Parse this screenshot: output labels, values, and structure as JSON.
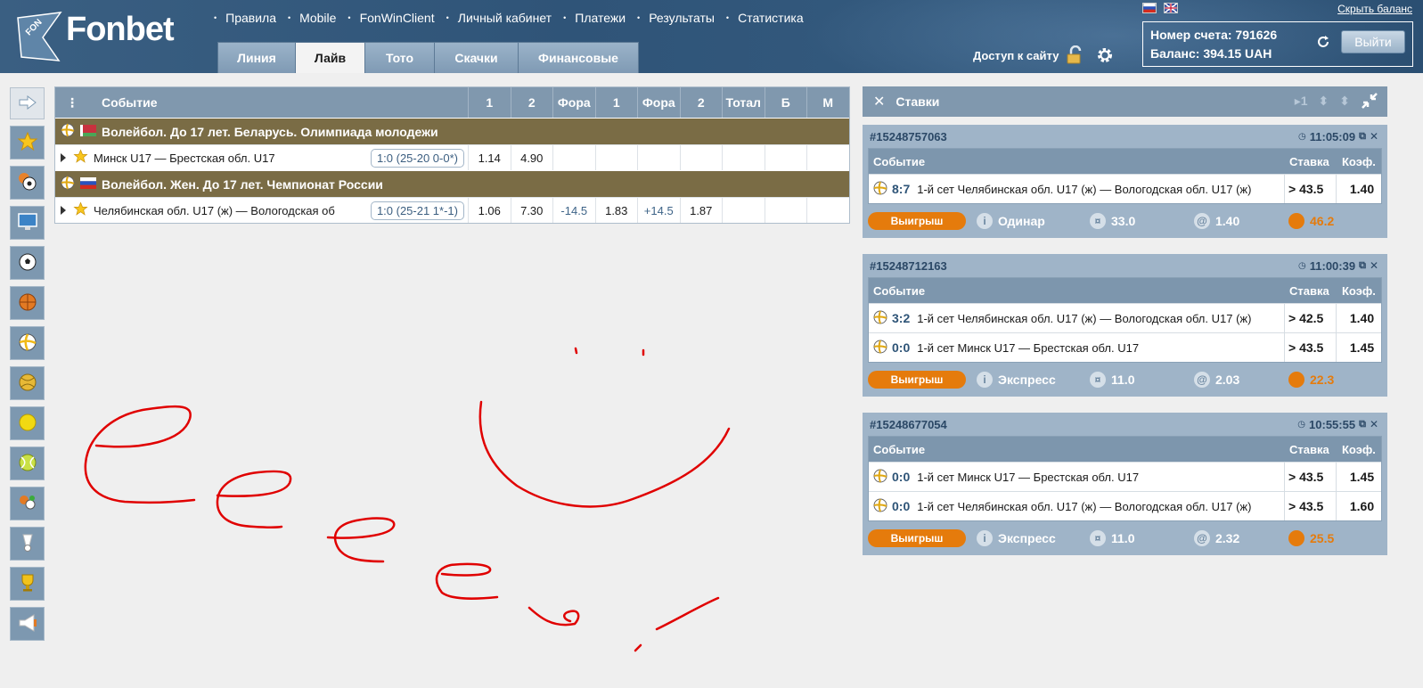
{
  "header": {
    "logo_text": "Fonbet",
    "logo_mark": "FON",
    "nav": [
      "Правила",
      "Mobile",
      "FonWinClient",
      "Личный кабинет",
      "Платежи",
      "Результаты",
      "Статистика"
    ],
    "tabs": [
      {
        "label": "Линия",
        "active": false
      },
      {
        "label": "Лайв",
        "active": true
      },
      {
        "label": "Тото",
        "active": false
      },
      {
        "label": "Скачки",
        "active": false
      },
      {
        "label": "Финансовые",
        "active": false
      }
    ],
    "access_label": "Доступ к сайту",
    "hide_balance": "Скрыть баланс",
    "account_label": "Номер счета: 791626",
    "balance_label": "Баланс: 394.15 UAH",
    "logout_label": "Выйти"
  },
  "sportbar": {
    "icons": [
      "arrow-right-icon",
      "star-icon",
      "multisport-icon",
      "monitor-icon",
      "football-icon",
      "basketball-icon",
      "volleyball-icon",
      "handball-icon",
      "tennis-icon",
      "tennis-ball-icon",
      "mixed-icon",
      "badminton-icon",
      "trophy-icon",
      "megaphone-icon"
    ]
  },
  "events": {
    "columns": [
      "Событие",
      "1",
      "2",
      "Фора",
      "1",
      "Фора",
      "2",
      "Тотал",
      "Б",
      "М"
    ],
    "groups": [
      {
        "title": "Волейбол. До 17 лет. Беларусь. Олимпиада молодежи",
        "flag": "belarus",
        "rows": [
          {
            "name": "Минск U17 — Брестская обл. U17",
            "score": "1:0 (25-20 0-0*)",
            "odds": [
              "1.14",
              "4.90",
              "",
              "",
              "",
              "",
              "",
              "",
              ""
            ]
          }
        ]
      },
      {
        "title": "Волейбол. Жен. До 17 лет. Чемпионат России",
        "flag": "russia",
        "rows": [
          {
            "name": "Челябинская обл. U17 (ж) — Вологодская об",
            "score": "1:0 (25-21 1*-1)",
            "odds": [
              "1.06",
              "7.30",
              "-14.5",
              "1.83",
              "+14.5",
              "1.87",
              "",
              "",
              ""
            ]
          }
        ]
      }
    ]
  },
  "bets_panel": {
    "title": "Ставки",
    "counter": "1",
    "col_event": "Событие",
    "col_stake": "Ставка",
    "col_coef": "Коэф.",
    "win_label": "Выигрыш",
    "bets": [
      {
        "id": "#15248757063",
        "time": "11:05:09",
        "lines": [
          {
            "score": "8:7",
            "text": "1-й сет Челябинская обл. U17 (ж) — Вологодская обл. U17 (ж)",
            "stake": "> 43.5",
            "coef": "1.40"
          }
        ],
        "type": "Одинар",
        "amount": "33.0",
        "total_coef": "1.40",
        "win": "46.2"
      },
      {
        "id": "#15248712163",
        "time": "11:00:39",
        "lines": [
          {
            "score": "3:2",
            "text": "1-й сет Челябинская обл. U17 (ж) — Вологодская обл. U17 (ж)",
            "stake": "> 42.5",
            "coef": "1.40"
          },
          {
            "score": "0:0",
            "text": "1-й сет Минск U17 — Брестская обл. U17",
            "stake": "> 43.5",
            "coef": "1.45"
          }
        ],
        "type": "Экспресс",
        "amount": "11.0",
        "total_coef": "2.03",
        "win": "22.3"
      },
      {
        "id": "#15248677054",
        "time": "10:55:55",
        "lines": [
          {
            "score": "0:0",
            "text": "1-й сет Минск U17 — Брестская обл. U17",
            "stake": "> 43.5",
            "coef": "1.45"
          },
          {
            "score": "0:0",
            "text": "1-й сет Челябинская обл. U17 (ж) — Вологодская обл. U17 (ж)",
            "stake": "> 43.5",
            "coef": "1.60"
          }
        ],
        "type": "Экспресс",
        "amount": "11.0",
        "total_coef": "2.32",
        "win": "25.5"
      }
    ]
  },
  "colors": {
    "header_bg": "#2f5478",
    "group_bg": "#7a6c45",
    "accent_orange": "#e57b0c",
    "table_head": "#8098ae",
    "scribble": "#e00000"
  }
}
